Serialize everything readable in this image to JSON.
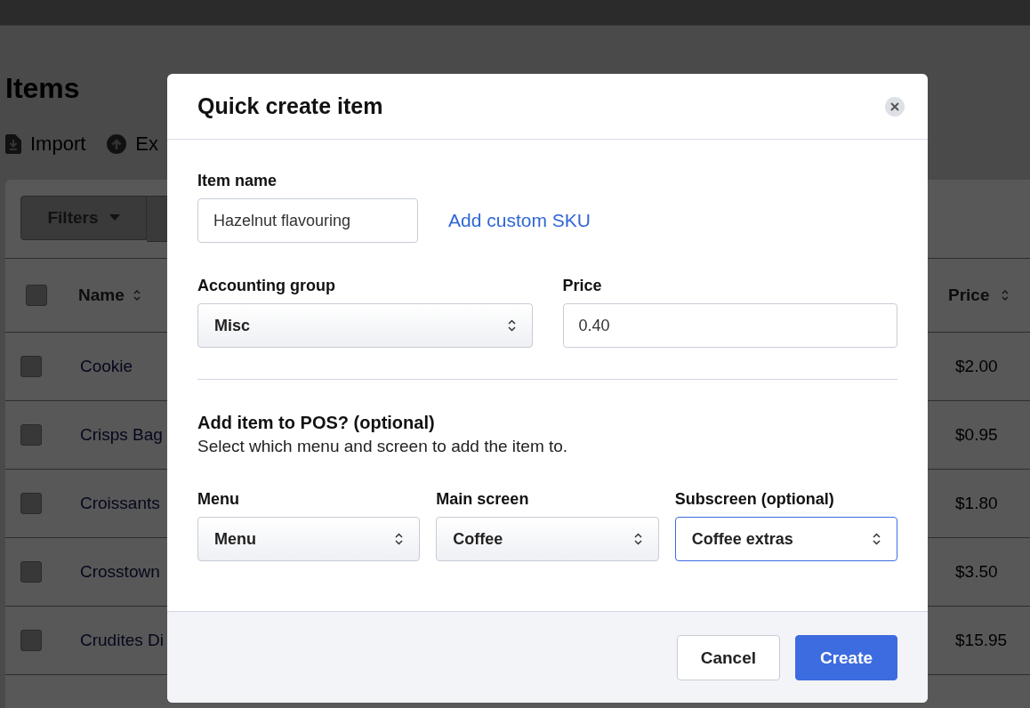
{
  "page": {
    "title": "Items",
    "toolbar": [
      {
        "kind": "import",
        "label": "Import"
      },
      {
        "kind": "export",
        "label": "Ex"
      }
    ],
    "filters_button": "Filters",
    "table": {
      "columns": [
        {
          "label": "Name"
        },
        {
          "label": "Price"
        }
      ],
      "all_checked": false,
      "rows": [
        {
          "name": "Cookie",
          "price": "$2.00",
          "checked": false
        },
        {
          "name": "Crisps Bag",
          "price": "$0.95",
          "checked": false
        },
        {
          "name": "Croissants",
          "price": "$1.80",
          "checked": false
        },
        {
          "name": "Crosstown",
          "price": "$3.50",
          "checked": false
        },
        {
          "name": "Crudites Di",
          "price": "$15.95",
          "checked": false
        }
      ]
    }
  },
  "modal": {
    "title": "Quick create item",
    "item_name": {
      "label": "Item name",
      "value": "Hazelnut flavouring"
    },
    "custom_sku_link": "Add custom SKU",
    "accounting_group": {
      "label": "Accounting group",
      "value": "Misc",
      "focused": false
    },
    "price": {
      "label": "Price",
      "value": "0.40"
    },
    "pos_section": {
      "heading": "Add item to POS? (optional)",
      "description": "Select which menu and screen to add the item to.",
      "selects": [
        {
          "label": "Menu",
          "value": "Menu",
          "focused": false
        },
        {
          "label": "Main screen",
          "value": "Coffee",
          "focused": false
        },
        {
          "label": "Subscreen (optional)",
          "value": "Coffee extras",
          "focused": true
        }
      ]
    },
    "buttons": [
      {
        "kind": "secondary",
        "label": "Cancel"
      },
      {
        "kind": "primary",
        "label": "Create"
      }
    ]
  }
}
